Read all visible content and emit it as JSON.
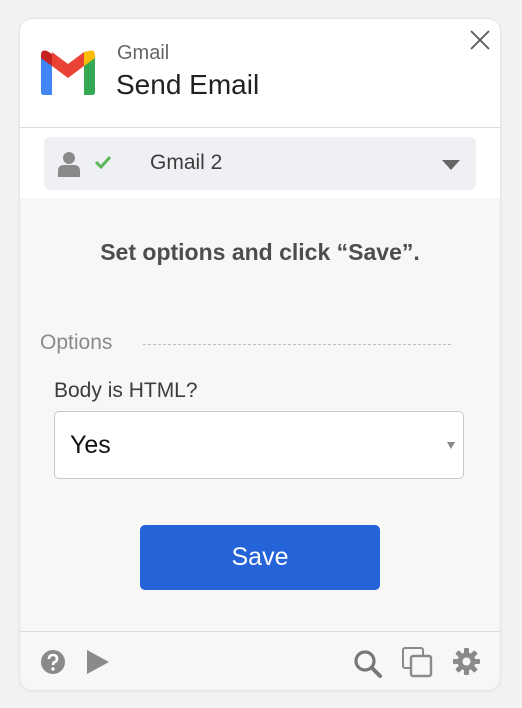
{
  "header": {
    "app_name": "Gmail",
    "title": "Send Email",
    "logo_icon": "gmail-logo-icon",
    "close_icon": "close-icon"
  },
  "account": {
    "label": "Gmail 2",
    "user_icon": "user-icon",
    "status_icon": "check-icon",
    "status_color": "#5cb85c"
  },
  "instruction": "Set options and click “Save”.",
  "options": {
    "section_label": "Options",
    "fields": [
      {
        "label": "Body is HTML?",
        "value": "Yes"
      }
    ]
  },
  "save_button": {
    "label": "Save",
    "color": "#2563d8"
  },
  "footer": {
    "icons": [
      "help-icon",
      "play-icon",
      "search-icon",
      "copy-icon",
      "gear-icon"
    ]
  }
}
